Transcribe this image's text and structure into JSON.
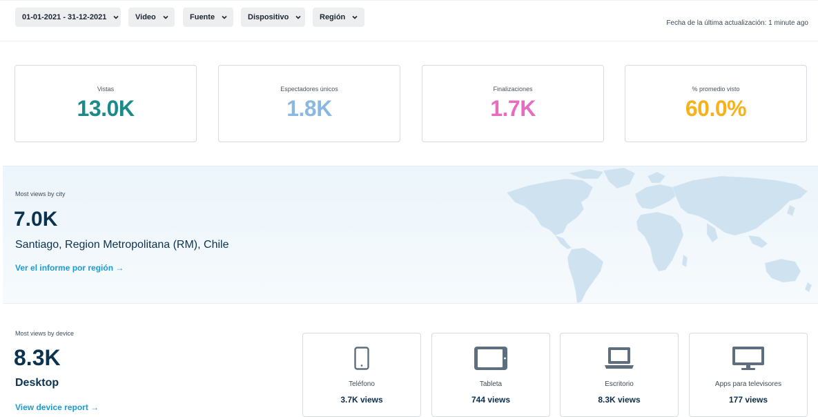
{
  "filters": {
    "date_range": "01-01-2021 - 31-12-2021",
    "video": "Video",
    "source": "Fuente",
    "device": "Dispositivo",
    "region": "Región"
  },
  "last_updated": "Fecha de la última actualización: 1 minute ago",
  "kpis": [
    {
      "label": "Vistas",
      "value": "13.0K",
      "color": "#1a8a8a"
    },
    {
      "label": "Espectadores únicos",
      "value": "1.8K",
      "color": "#8bb8e0"
    },
    {
      "label": "Finalizaciones",
      "value": "1.7K",
      "color": "#e86bbf"
    },
    {
      "label": "% promedio visto",
      "value": "60.0%",
      "color": "#f5b21b"
    }
  ],
  "geo": {
    "eyebrow": "Most views by city",
    "value": "7.0K",
    "city": "Santiago, Region Metropolitana (RM), Chile",
    "link": "Ver el informe por región →"
  },
  "device": {
    "eyebrow": "Most views by device",
    "value": "8.3K",
    "name": "Desktop",
    "link": "View device report →",
    "cards": [
      {
        "name": "Teléfono",
        "views": "3.7K views",
        "icon": "phone-icon"
      },
      {
        "name": "Tableta",
        "views": "744 views",
        "icon": "tablet-icon"
      },
      {
        "name": "Escritorio",
        "views": "8.3K views",
        "icon": "laptop-icon"
      },
      {
        "name": "Apps para televisores",
        "views": "177 views",
        "icon": "tv-icon"
      }
    ]
  },
  "colors": {
    "accent_link": "#1a9ad6",
    "icon": "#5d6f7f",
    "map_land": "#cfe2ef"
  }
}
